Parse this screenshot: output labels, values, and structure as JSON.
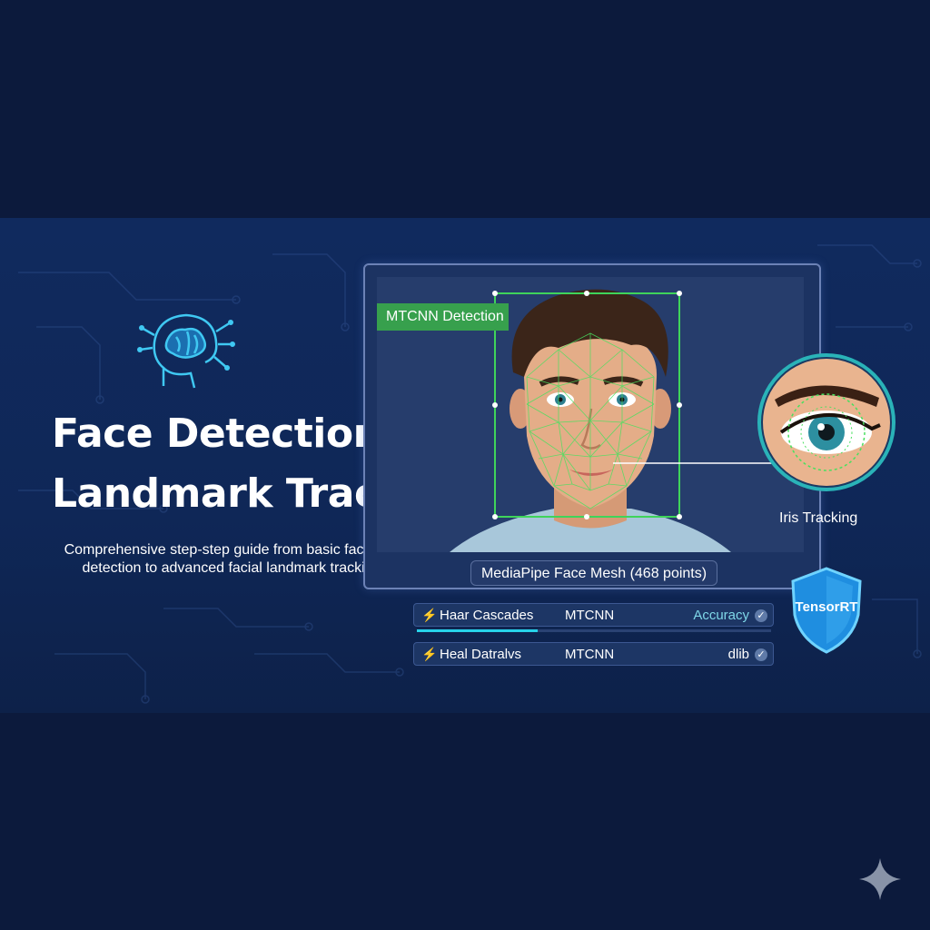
{
  "title_lines": [
    "Face Detection &",
    "Landmark Tracking"
  ],
  "subtitle_lines": [
    "Comprehensive step-step guide from basic face",
    "detection to advanced facial landmark tracking"
  ],
  "detection_label": "MTCNN Detection",
  "mesh_label": "MediaPipe Face Mesh (468 points)",
  "iris_label": "Iris Tracking",
  "shield_label": "TensorRT",
  "rows": [
    {
      "col1": "Haar Cascades",
      "col2": "MTCNN",
      "col3": "Accuracy"
    },
    {
      "col1": "Heal Datralvs",
      "col2": "MTCNN",
      "col3": "dlib"
    }
  ],
  "progress_fraction": 0.34,
  "colors": {
    "background": "#0c1a3c",
    "band": "#102a5e",
    "accent_green": "#37a04d",
    "accent_cyan": "#27d3ea",
    "shield_blue": "#1f8ee0"
  },
  "icons": [
    "brain-head-icon",
    "bolt-icon",
    "check-icon",
    "shield-icon",
    "sparkle-icon"
  ]
}
